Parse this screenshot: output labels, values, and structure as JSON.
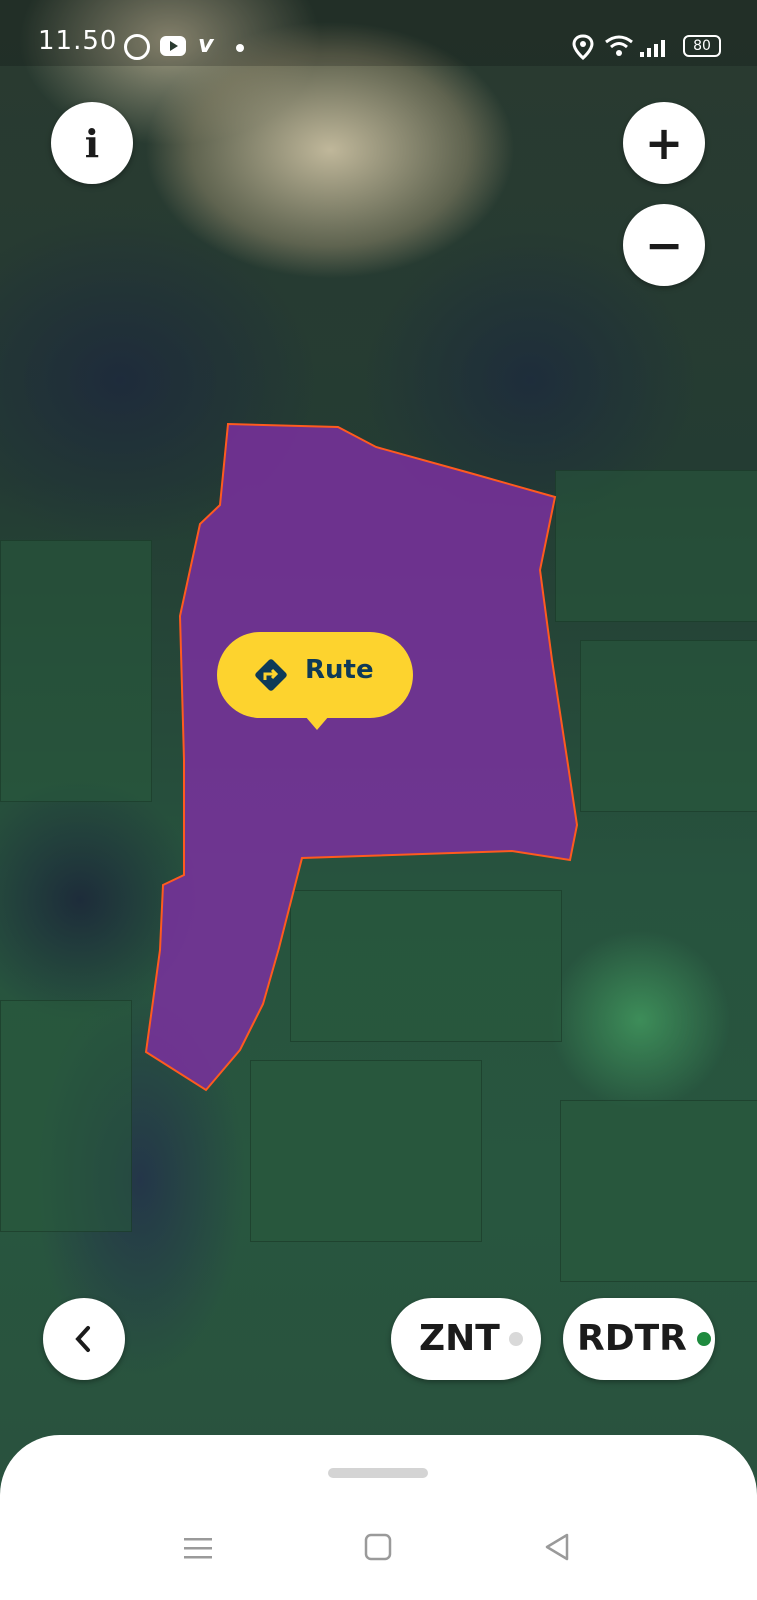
{
  "status_bar": {
    "time": "11.50",
    "notification_icons": [
      "whatsapp-icon",
      "youtube-icon",
      "vimeo-icon",
      "dot-icon"
    ],
    "battery": "80"
  },
  "map": {
    "imagery": "satellite",
    "parcel_fill_color": "#7e2fa2",
    "parcel_stroke_color": "#ff5a1f"
  },
  "route_bubble": {
    "label": "Rute",
    "color": "#fdd32e",
    "icon": "directions-icon",
    "text_color": "#0e3a57"
  },
  "controls": {
    "info_label": "i",
    "zoom_in_label": "+",
    "zoom_out_label": "−",
    "back_label": "‹"
  },
  "layers": {
    "znt": {
      "label": "ZNT",
      "active": false,
      "dot_color": "#d9d9d9"
    },
    "rdtr": {
      "label": "RDTR",
      "active": true,
      "dot_color": "#1e8a3e"
    }
  },
  "bottom_sheet": {
    "handle": "drag-handle"
  },
  "nav_bar": {
    "icons": [
      "menu-icon",
      "home-square-icon",
      "back-triangle-icon"
    ]
  }
}
